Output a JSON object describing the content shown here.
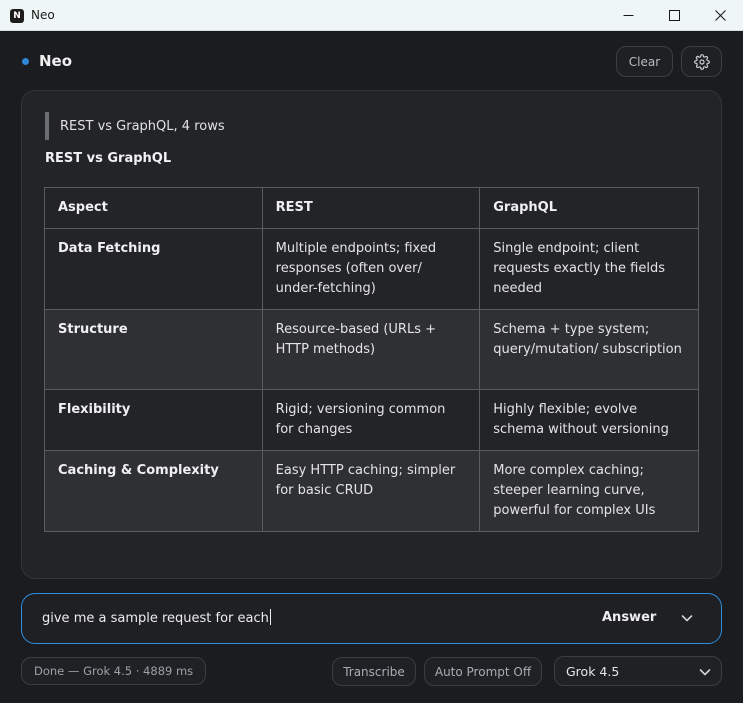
{
  "window": {
    "title": "Neo",
    "app_icon_glyph": "N"
  },
  "header": {
    "title": "Neo",
    "clear_label": "Clear"
  },
  "response": {
    "quote": "REST vs GraphQL, 4 rows",
    "table_title": "REST vs GraphQL",
    "columns": [
      "Aspect",
      "REST",
      "GraphQL"
    ],
    "rows": [
      [
        "Data Fetching",
        "Multiple endpoints; fixed responses (often over/ under-fetching)",
        "Single endpoint; client requests exactly the fields needed"
      ],
      [
        "Structure",
        "Resource-based (URLs + HTTP methods)",
        "Schema + type system; query/mutation/ subscription"
      ],
      [
        "Flexibility",
        "Rigid; versioning common for changes",
        "Highly flexible; evolve schema without versioning"
      ],
      [
        "Caching & Complexity",
        "Easy HTTP caching; simpler for basic CRUD",
        "More complex caching; steeper learning curve, powerful for complex UIs"
      ]
    ]
  },
  "input": {
    "value": "give me a sample request for each",
    "mode_label": "Answer"
  },
  "footer": {
    "status": "Done — Grok 4.5 · 4889 ms",
    "transcribe_label": "Transcribe",
    "auto_prompt_label": "Auto Prompt Off",
    "model_label": "Grok 4.5"
  },
  "colors": {
    "accent": "#2f8ddd",
    "status_dot": "#2d86d6",
    "background": "#1b1c1f",
    "panel": "#232427"
  },
  "icons": [
    "app-logo-icon",
    "minimize-icon",
    "maximize-icon",
    "close-icon",
    "gear-icon",
    "chevron-down-icon"
  ]
}
